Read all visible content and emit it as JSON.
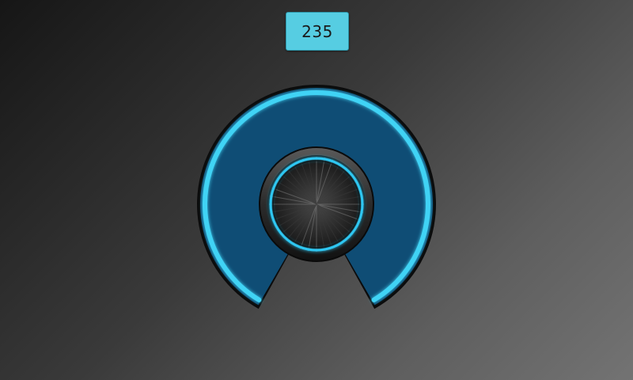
{
  "display": {
    "value": "235"
  },
  "knob": {
    "level_fraction": 1.0,
    "track_color": "#0f4d75",
    "glow_color": "#3fd3f5",
    "ring_color": "#2ec7f2",
    "frame_color": "#0b0b0b"
  }
}
